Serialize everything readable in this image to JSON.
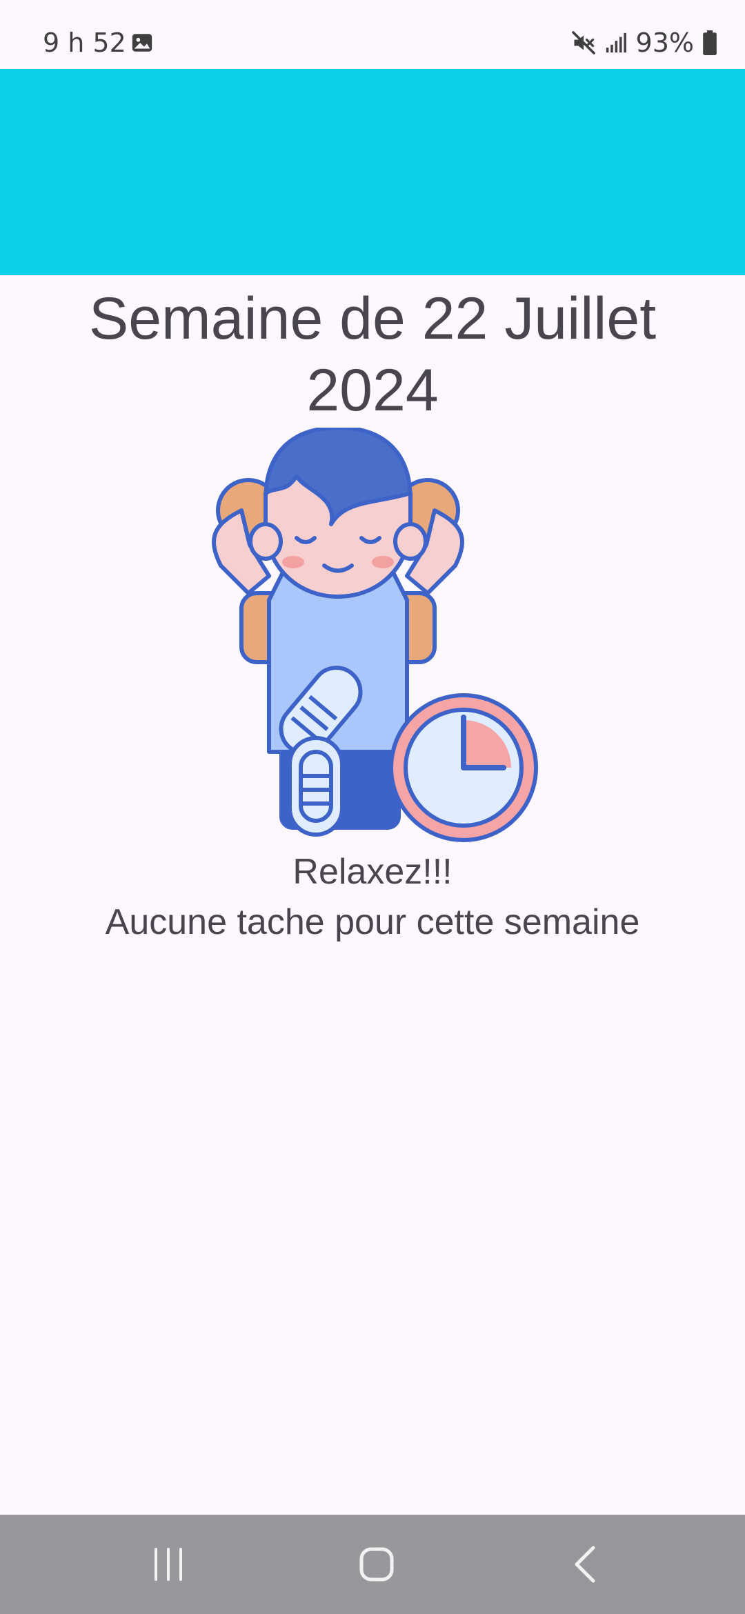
{
  "status_bar": {
    "time": "9 h 52",
    "battery": "93%",
    "icons": [
      "gallery-icon",
      "mute-icon",
      "signal-icon",
      "battery-icon"
    ]
  },
  "app_bar": {
    "color": "#0DCFE8"
  },
  "main": {
    "title": "Semaine de 22 Juillet 2024",
    "illustration": "relaxing-person-with-clock",
    "message_title": "Relaxez!!!",
    "message_subtitle": "Aucune tache pour cette semaine"
  },
  "navigation": {
    "buttons": [
      "recent-apps-icon",
      "home-icon",
      "back-icon"
    ]
  },
  "colors": {
    "background": "#FDF7FE",
    "text": "#49454F",
    "accent": "#0DCFE8",
    "nav_bar": "#9A979C"
  }
}
